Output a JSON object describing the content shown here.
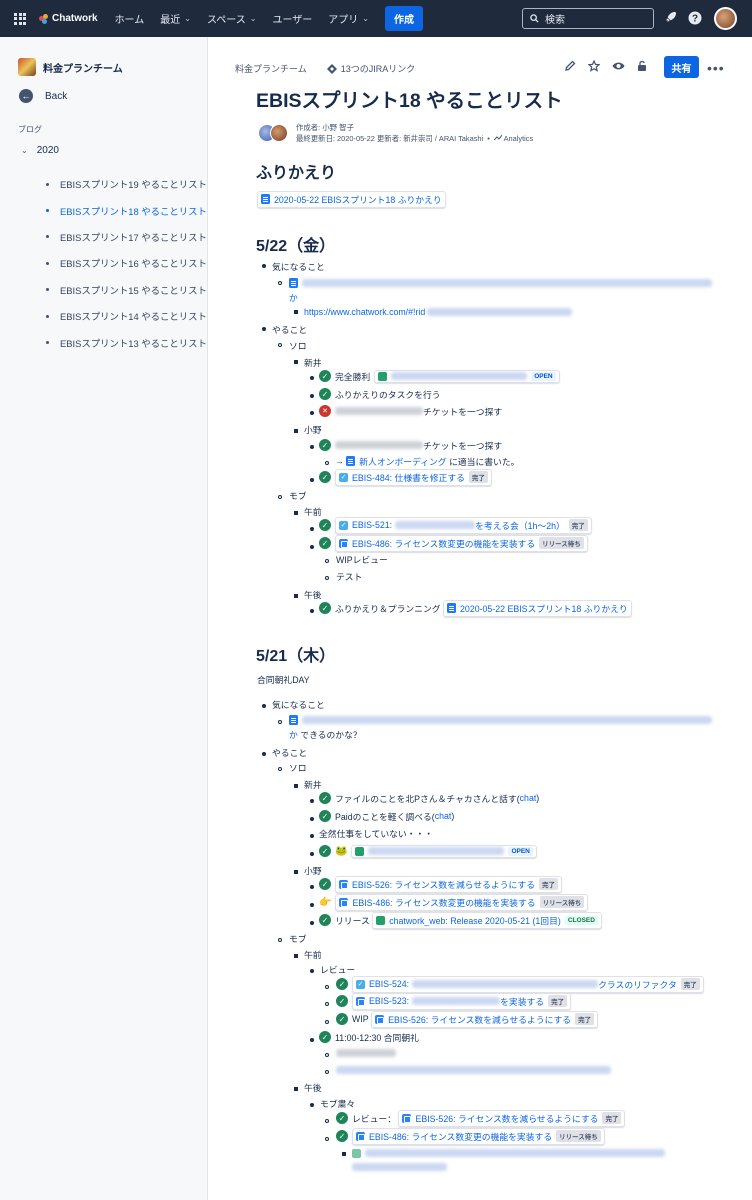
{
  "topnav": {
    "brand": "Chatwork",
    "items": [
      "ホーム",
      "最近",
      "スペース",
      "ユーザー",
      "アプリ"
    ],
    "create": "作成",
    "search_placeholder": "検索"
  },
  "sidebar": {
    "space_name": "料金プランチーム",
    "back": "Back",
    "section_label": "ブログ",
    "year": "2020",
    "posts": [
      "EBISスプリント19 やることリスト",
      "EBISスプリント18 やることリスト",
      "EBISスプリント17 やることリスト",
      "EBISスプリント16 やることリスト",
      "EBISスプリント15 やることリスト",
      "EBISスプリント14 やることリスト",
      "EBISスプリント13 やることリスト"
    ],
    "active_index": 1
  },
  "header": {
    "breadcrumb_space": "料金プランチーム",
    "jira_links": "13つのJIRAリンク",
    "share": "共有",
    "title": "EBISスプリント18 やることリスト",
    "author_line": "作成者: 小野 智子",
    "updated_line": "最終更新日: 2020-05-22 更新者: 新井崇司 / ARAI Takashi",
    "analytics": "Analytics"
  },
  "s1": {
    "heading": "ふりかえり",
    "link": "2020-05-22 EBISスプリント18 ふりかえり"
  },
  "s2": {
    "heading": "5/22（金）",
    "kininaru": "気になること",
    "ka": "か",
    "url": "https://www.chatwork.com/#!rid",
    "yarukoto": "やること",
    "solo": "ソロ",
    "arai": "新井",
    "kanzen": "完全勝利",
    "open": "OPEN",
    "furikaeri_task": "ふりかえりのタスクを行う",
    "ticket_find": "チケットを一つ探す",
    "ono": "小野",
    "arrow": "→",
    "onboarding": "新人オンボーディング",
    "tekitou": "に適当に書いた。",
    "ebis484": "EBIS-484: 仕様書を修正する",
    "done": "完了",
    "mob": "モブ",
    "gozen": "午前",
    "ebis521": "EBIS-521:",
    "kangaeru": "を考える会（1h〜2h）",
    "ebis486": "EBIS-486: ライセンス数変更の機能を実装する",
    "release_wait": "リリース待ち",
    "wip_review": "WIPレビュー",
    "test": "テスト",
    "gogo": "午後",
    "furikaeri_planning": "ふりかえり＆プランニング",
    "furikaeri_link": "2020-05-22 EBISスプリント18 ふりかえり"
  },
  "s3": {
    "heading": "5/21（木）",
    "goudou": "合同朝礼DAY",
    "kininaru": "気になること",
    "ka": "か",
    "dekiru": "できるのかな？",
    "yarukoto": "やること",
    "solo": "ソロ",
    "arai": "新井",
    "file": "ファイルのことを北Pさん＆チャカさんと話す(",
    "chat": "chat",
    "close_paren": ")",
    "paid": "Paidのことを軽く調べる(",
    "zenzen": "全然仕事をしていない・・・",
    "open": "OPEN",
    "ono": "小野",
    "ebis526": "EBIS-526: ライセンス数を減らせるようにする",
    "done": "完了",
    "ebis486": "EBIS-486: ライセンス数変更の機能を実装する",
    "release_wait": "リリース待ち",
    "release": "リリース",
    "release_link": "chatwork_web: Release 2020-05-21 (1回目)",
    "closed": "CLOSED",
    "mob": "モブ",
    "gozen": "午前",
    "review": "レビュー",
    "ebis524": "EBIS-524:",
    "refactor": "クラスのリファクタ",
    "ebis523": "EBIS-523:",
    "jissou": "を実装する",
    "wip": "WIP",
    "asakai": "11:00-12:30 合同朝礼",
    "gogo": "午後",
    "mob_shukushuku": "モブ粛々",
    "review_colon": "レビュー："
  },
  "colors": {
    "nav_bg": "#1f2a3c",
    "accent": "#0c66e4",
    "success": "#1f845a",
    "error": "#c9372c"
  }
}
